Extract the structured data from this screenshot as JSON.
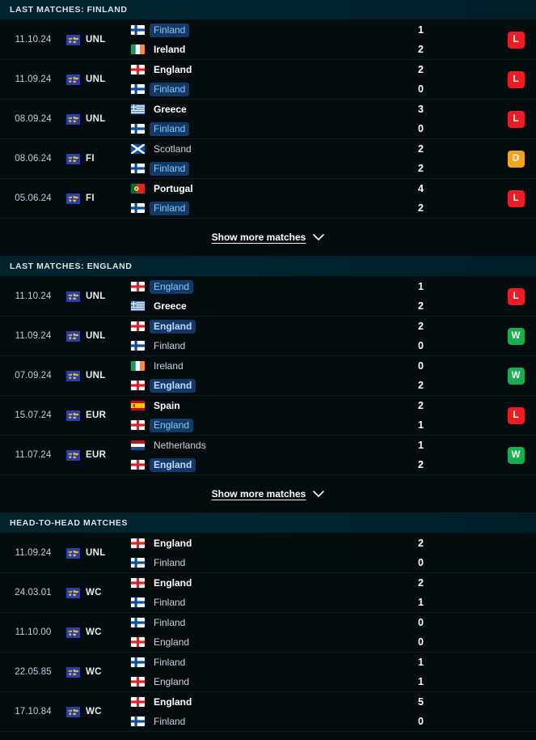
{
  "colors": {
    "win": "#18ad4e",
    "loss": "#ec1c24",
    "draw": "#f3a31c",
    "highlight_bg": "#123a66",
    "header_bg": "#00222d",
    "row_bg": "#050c10"
  },
  "show_more": {
    "label": "Show more matches",
    "icon": "chevron-down-icon"
  },
  "sections": [
    {
      "id": "last-matches-finland",
      "title": "LAST MATCHES: FINLAND",
      "has_show_more": true,
      "matches": [
        {
          "date": "11.10.24",
          "competition": "UNL",
          "competition_icon": "world-map-icon",
          "home": {
            "name": "Finland",
            "flag": "fi",
            "highlight": true,
            "winner": false
          },
          "away": {
            "name": "Ireland",
            "flag": "ie",
            "highlight": false,
            "winner": true
          },
          "home_score": "1",
          "away_score": "2",
          "result": "L"
        },
        {
          "date": "11.09.24",
          "competition": "UNL",
          "competition_icon": "world-map-icon",
          "home": {
            "name": "England",
            "flag": "eng",
            "highlight": false,
            "winner": true
          },
          "away": {
            "name": "Finland",
            "flag": "fi",
            "highlight": true,
            "winner": false
          },
          "home_score": "2",
          "away_score": "0",
          "result": "L"
        },
        {
          "date": "08.09.24",
          "competition": "UNL",
          "competition_icon": "world-map-icon",
          "home": {
            "name": "Greece",
            "flag": "gr",
            "highlight": false,
            "winner": true
          },
          "away": {
            "name": "Finland",
            "flag": "fi",
            "highlight": true,
            "winner": false
          },
          "home_score": "3",
          "away_score": "0",
          "result": "L"
        },
        {
          "date": "08.06.24",
          "competition": "FI",
          "competition_icon": "world-map-icon",
          "home": {
            "name": "Scotland",
            "flag": "sco",
            "highlight": false,
            "winner": false
          },
          "away": {
            "name": "Finland",
            "flag": "fi",
            "highlight": true,
            "winner": false
          },
          "home_score": "2",
          "away_score": "2",
          "result": "D"
        },
        {
          "date": "05.06.24",
          "competition": "FI",
          "competition_icon": "world-map-icon",
          "home": {
            "name": "Portugal",
            "flag": "pt",
            "highlight": false,
            "winner": true
          },
          "away": {
            "name": "Finland",
            "flag": "fi",
            "highlight": true,
            "winner": false
          },
          "home_score": "4",
          "away_score": "2",
          "result": "L"
        }
      ]
    },
    {
      "id": "last-matches-england",
      "title": "LAST MATCHES: ENGLAND",
      "has_show_more": true,
      "matches": [
        {
          "date": "11.10.24",
          "competition": "UNL",
          "competition_icon": "world-map-icon",
          "home": {
            "name": "England",
            "flag": "eng",
            "highlight": true,
            "winner": false
          },
          "away": {
            "name": "Greece",
            "flag": "gr",
            "highlight": false,
            "winner": true
          },
          "home_score": "1",
          "away_score": "2",
          "result": "L"
        },
        {
          "date": "11.09.24",
          "competition": "UNL",
          "competition_icon": "world-map-icon",
          "home": {
            "name": "England",
            "flag": "eng",
            "highlight": true,
            "winner": true
          },
          "away": {
            "name": "Finland",
            "flag": "fi",
            "highlight": false,
            "winner": false
          },
          "home_score": "2",
          "away_score": "0",
          "result": "W"
        },
        {
          "date": "07.09.24",
          "competition": "UNL",
          "competition_icon": "world-map-icon",
          "home": {
            "name": "Ireland",
            "flag": "ie",
            "highlight": false,
            "winner": false
          },
          "away": {
            "name": "England",
            "flag": "eng",
            "highlight": true,
            "winner": true
          },
          "home_score": "0",
          "away_score": "2",
          "result": "W"
        },
        {
          "date": "15.07.24",
          "competition": "EUR",
          "competition_icon": "world-map-icon",
          "home": {
            "name": "Spain",
            "flag": "es",
            "highlight": false,
            "winner": true
          },
          "away": {
            "name": "England",
            "flag": "eng",
            "highlight": true,
            "winner": false
          },
          "home_score": "2",
          "away_score": "1",
          "result": "L"
        },
        {
          "date": "11.07.24",
          "competition": "EUR",
          "competition_icon": "world-map-icon",
          "home": {
            "name": "Netherlands",
            "flag": "nl",
            "highlight": false,
            "winner": false
          },
          "away": {
            "name": "England",
            "flag": "eng",
            "highlight": true,
            "winner": true
          },
          "home_score": "1",
          "away_score": "2",
          "result": "W"
        }
      ]
    },
    {
      "id": "head-to-head-matches",
      "title": "HEAD-TO-HEAD MATCHES",
      "has_show_more": false,
      "matches": [
        {
          "date": "11.09.24",
          "competition": "UNL",
          "competition_icon": "world-map-icon",
          "home": {
            "name": "England",
            "flag": "eng",
            "highlight": false,
            "winner": true
          },
          "away": {
            "name": "Finland",
            "flag": "fi",
            "highlight": false,
            "winner": false
          },
          "home_score": "2",
          "away_score": "0",
          "result": ""
        },
        {
          "date": "24.03.01",
          "competition": "WC",
          "competition_icon": "world-map-icon",
          "home": {
            "name": "England",
            "flag": "eng",
            "highlight": false,
            "winner": true
          },
          "away": {
            "name": "Finland",
            "flag": "fi",
            "highlight": false,
            "winner": false
          },
          "home_score": "2",
          "away_score": "1",
          "result": ""
        },
        {
          "date": "11.10.00",
          "competition": "WC",
          "competition_icon": "world-map-icon",
          "home": {
            "name": "Finland",
            "flag": "fi",
            "highlight": false,
            "winner": false
          },
          "away": {
            "name": "England",
            "flag": "eng",
            "highlight": false,
            "winner": false
          },
          "home_score": "0",
          "away_score": "0",
          "result": ""
        },
        {
          "date": "22.05.85",
          "competition": "WC",
          "competition_icon": "world-map-icon",
          "home": {
            "name": "Finland",
            "flag": "fi",
            "highlight": false,
            "winner": false
          },
          "away": {
            "name": "England",
            "flag": "eng",
            "highlight": false,
            "winner": false
          },
          "home_score": "1",
          "away_score": "1",
          "result": ""
        },
        {
          "date": "17.10.84",
          "competition": "WC",
          "competition_icon": "world-map-icon",
          "home": {
            "name": "England",
            "flag": "eng",
            "highlight": false,
            "winner": true
          },
          "away": {
            "name": "Finland",
            "flag": "fi",
            "highlight": false,
            "winner": false
          },
          "home_score": "5",
          "away_score": "0",
          "result": ""
        }
      ]
    }
  ]
}
